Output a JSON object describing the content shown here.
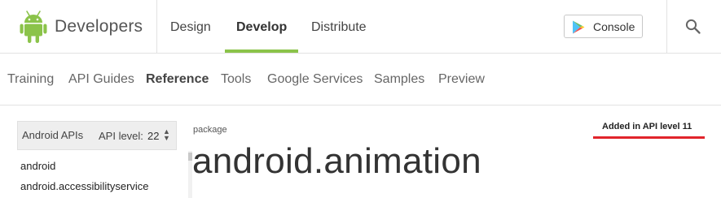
{
  "header": {
    "brand": "Developers",
    "nav": [
      {
        "label": "Design"
      },
      {
        "label": "Develop",
        "active": true
      },
      {
        "label": "Distribute"
      }
    ],
    "console_label": "Console",
    "accent_color": "#8bc34a"
  },
  "subnav": {
    "items": [
      {
        "label": "Training"
      },
      {
        "label": "API Guides"
      },
      {
        "label": "Reference",
        "active": true
      },
      {
        "label": "Tools"
      },
      {
        "label": "Google Services"
      },
      {
        "label": "Samples"
      },
      {
        "label": "Preview"
      }
    ]
  },
  "sidebar": {
    "title": "Android APIs",
    "api_level_label": "API level:",
    "api_level_value": "22",
    "packages": [
      "android",
      "android.accessibilityservice"
    ]
  },
  "main": {
    "kind": "package",
    "added_in": "Added in API level 11",
    "added_underline_color": "#e1242b",
    "title": "android.animation"
  },
  "icons": [
    "android-logo",
    "play-store-icon",
    "search-icon",
    "select-arrows-icon"
  ]
}
